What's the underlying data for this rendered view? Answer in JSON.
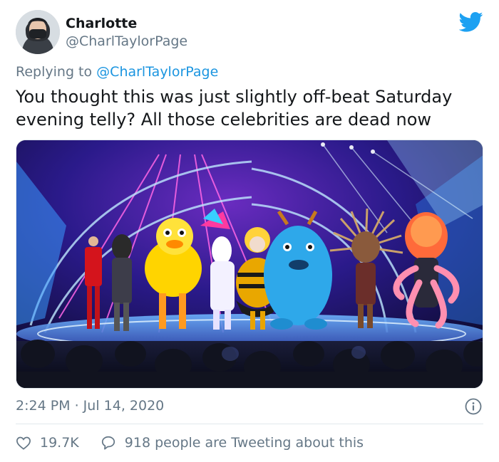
{
  "author": {
    "name": "Charlotte",
    "handle": "@CharlTaylorPage"
  },
  "reply": {
    "prefix": "Replying to",
    "to": "@CharlTaylorPage"
  },
  "tweet": {
    "text": "You thought this was just slightly off-beat Saturday evening telly? All those celebrities are dead now"
  },
  "media": {
    "kind": "photo"
  },
  "meta": {
    "time": "2:24 PM · Jul 14, 2020"
  },
  "actions": {
    "likes": "19.7K",
    "conversation": "918 people are Tweeting about this"
  },
  "icons": {
    "logo": "twitter-bird-icon",
    "info": "info-icon",
    "like": "heart-icon",
    "reply": "speech-bubble-icon"
  },
  "colors": {
    "brand": "#1da1f2",
    "link": "#1b95e0",
    "secondary_text": "#657786",
    "primary_text": "#14171a"
  }
}
